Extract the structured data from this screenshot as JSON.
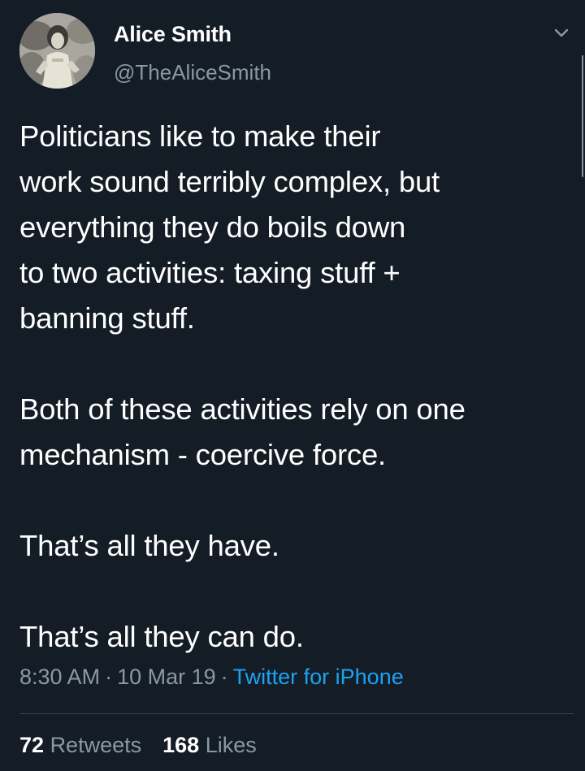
{
  "author": {
    "name": "Alice Smith",
    "handle": "@TheAliceSmith"
  },
  "tweet": {
    "paragraphs": [
      [
        "Politicians like to make their",
        "work sound terribly complex, but",
        "everything they do boils down",
        "to two activities: taxing stuff +",
        "banning stuff."
      ],
      [
        "Both of these activities rely on one",
        "mechanism - coercive force."
      ],
      [
        "That’s all they have."
      ],
      [
        "That’s all they can do."
      ]
    ]
  },
  "meta": {
    "time": "8:30 AM",
    "date": "10 Mar 19",
    "separator": "·",
    "source": "Twitter for iPhone"
  },
  "stats": {
    "retweets_count": "72",
    "retweets_label": "Retweets",
    "likes_count": "168",
    "likes_label": "Likes"
  },
  "colors": {
    "background": "#141d26",
    "text": "#ffffff",
    "secondary": "#8899a6",
    "link": "#1da1f2"
  },
  "icons": {
    "caret": "chevron-down-icon"
  }
}
